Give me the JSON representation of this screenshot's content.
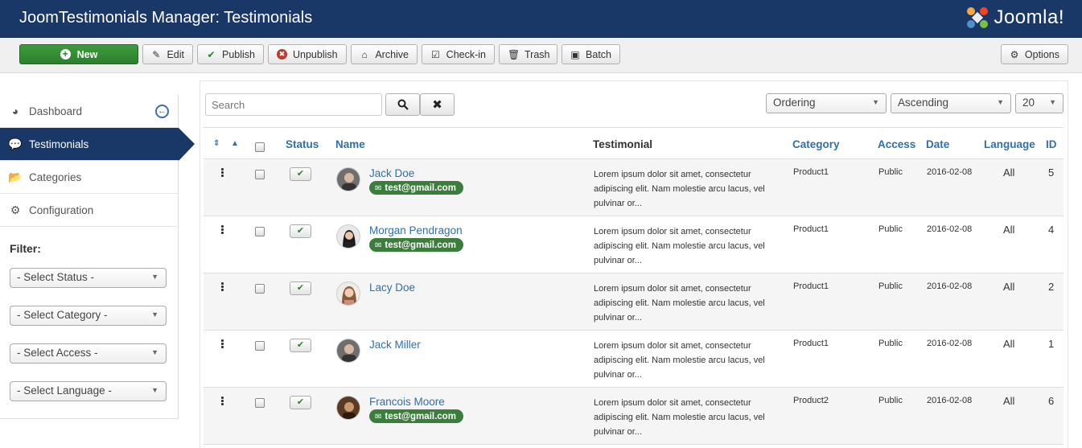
{
  "header": {
    "title": "JoomTestimonials Manager: Testimonials",
    "logo_text": "Joomla!"
  },
  "toolbar": {
    "new": "New",
    "edit": "Edit",
    "publish": "Publish",
    "unpublish": "Unpublish",
    "archive": "Archive",
    "checkin": "Check-in",
    "trash": "Trash",
    "batch": "Batch",
    "options": "Options"
  },
  "sidebar": {
    "items": [
      {
        "label": "Dashboard",
        "icon": "dashboard-icon"
      },
      {
        "label": "Testimonials",
        "icon": "comment-icon"
      },
      {
        "label": "Categories",
        "icon": "folder-icon"
      },
      {
        "label": "Configuration",
        "icon": "gear-icon"
      }
    ],
    "filter_label": "Filter:",
    "filters": [
      "- Select Status -",
      "- Select Category -",
      "- Select Access -",
      "- Select Language -"
    ]
  },
  "search": {
    "placeholder": "Search"
  },
  "sort": {
    "ordering": "Ordering",
    "direction": "Ascending",
    "limit": "20"
  },
  "table": {
    "headers": {
      "status": "Status",
      "name": "Name",
      "testimonial": "Testimonial",
      "category": "Category",
      "access": "Access",
      "date": "Date",
      "language": "Language",
      "id": "ID"
    },
    "rows": [
      {
        "name": "Jack Doe",
        "email": "test@gmail.com",
        "testimonial": "Lorem ipsum dolor sit amet, consectetur adipiscing elit. Nam molestie arcu lacus, vel pulvinar or...",
        "category": "Product1",
        "access": "Public",
        "date": "2016-02-08",
        "language": "All",
        "id": "5"
      },
      {
        "name": "Morgan Pendragon",
        "email": "test@gmail.com",
        "testimonial": "Lorem ipsum dolor sit amet, consectetur adipiscing elit. Nam molestie arcu lacus, vel pulvinar or...",
        "category": "Product1",
        "access": "Public",
        "date": "2016-02-08",
        "language": "All",
        "id": "4"
      },
      {
        "name": "Lacy Doe",
        "email": "",
        "testimonial": "Lorem ipsum dolor sit amet, consectetur adipiscing elit. Nam molestie arcu lacus, vel pulvinar or...",
        "category": "Product1",
        "access": "Public",
        "date": "2016-02-08",
        "language": "All",
        "id": "2"
      },
      {
        "name": "Jack Miller",
        "email": "",
        "testimonial": "Lorem ipsum dolor sit amet, consectetur adipiscing elit. Nam molestie arcu lacus, vel pulvinar or...",
        "category": "Product1",
        "access": "Public",
        "date": "2016-02-08",
        "language": "All",
        "id": "1"
      },
      {
        "name": "Francois Moore",
        "email": "test@gmail.com",
        "testimonial": "Lorem ipsum dolor sit amet, consectetur adipiscing elit. Nam molestie arcu lacus, vel pulvinar or...",
        "category": "Product2",
        "access": "Public",
        "date": "2016-02-08",
        "language": "All",
        "id": "6"
      }
    ]
  }
}
